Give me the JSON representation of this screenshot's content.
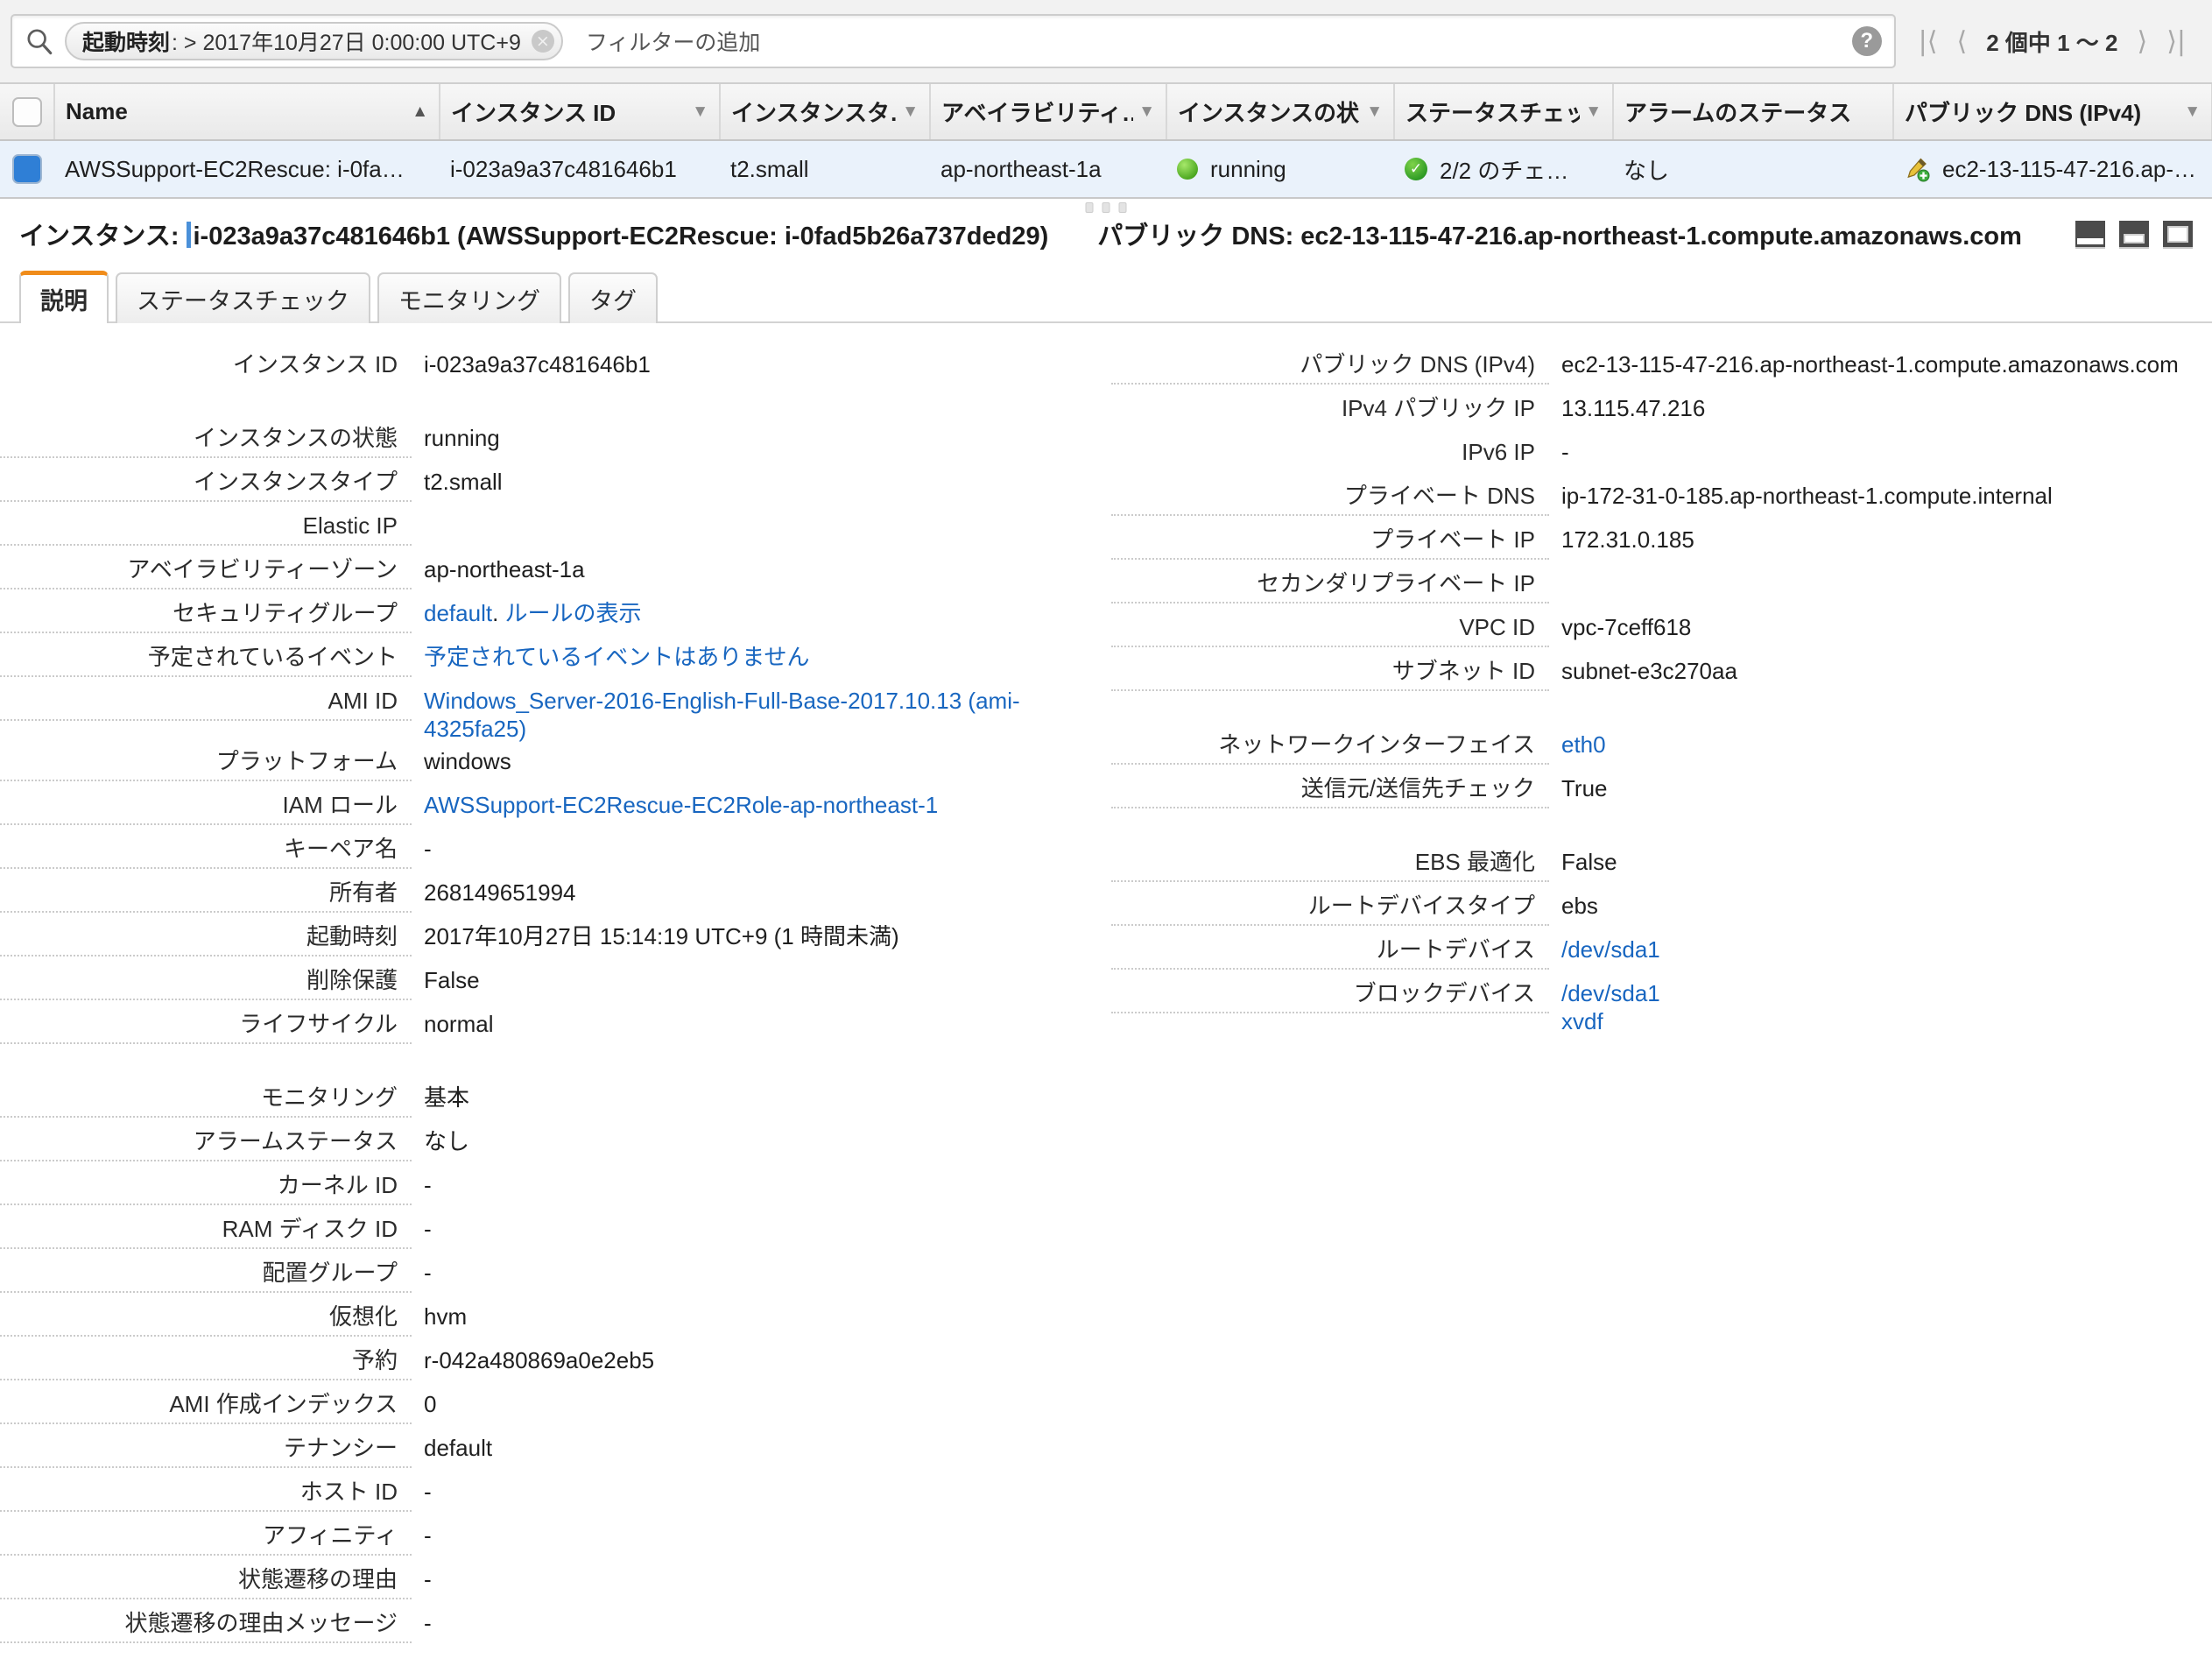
{
  "search": {
    "icon": "search-icon",
    "filter_token": {
      "key": "起動時刻",
      "operator_value": " : > 2017年10月27日 0:00:00 UTC+9",
      "remove_icon": "×"
    },
    "placeholder_text": "フィルターの追加",
    "help_icon": "?"
  },
  "pager": {
    "first": "|⟨",
    "prev": "⟨",
    "count_label": "2 個中 1 〜 2",
    "next": "⟩",
    "last": "⟩|"
  },
  "table": {
    "columns": [
      {
        "label": "Name",
        "sort": "▲",
        "sort_state": "asc"
      },
      {
        "label": "インスタンス ID",
        "sort": "▼",
        "sort_state": "none"
      },
      {
        "label": "インスタンスタ…",
        "sort": "▼",
        "sort_state": "none"
      },
      {
        "label": "アベイラビリティ…",
        "sort": "▼",
        "sort_state": "none"
      },
      {
        "label": "インスタンスの状",
        "sort": "▼",
        "sort_state": "none"
      },
      {
        "label": "ステータスチェッ",
        "sort": "▼",
        "sort_state": "none"
      },
      {
        "label": "アラームのステータス",
        "sort": "",
        "sort_state": "none"
      },
      {
        "label": "パブリック DNS (IPv4)",
        "sort": "▼",
        "sort_state": "none"
      }
    ],
    "rows": [
      {
        "selected": true,
        "name": "AWSSupport-EC2Rescue: i-0fa…",
        "instance_id": "i-023a9a37c481646b1",
        "instance_type": "t2.small",
        "availability_zone": "ap-northeast-1a",
        "state": "running",
        "status_check": "2/2 のチェ…",
        "alarm_status": "なし",
        "public_dns": "ec2-13-115-47-216.ap-…"
      }
    ]
  },
  "detail_header": {
    "prefix": "インスタンス:",
    "instance_title": "i-023a9a37c481646b1 (AWSSupport-EC2Rescue: i-0fad5b26a737ded29)",
    "dns_label": "パブリック DNS: ec2-13-115-47-216.ap-northeast-1.compute.amazonaws.com",
    "window_buttons": [
      "minimize-panel",
      "half-panel",
      "maximize-panel"
    ]
  },
  "tabs": [
    {
      "label": "説明",
      "active": true
    },
    {
      "label": "ステータスチェック",
      "active": false
    },
    {
      "label": "モニタリング",
      "active": false
    },
    {
      "label": "タグ",
      "active": false
    }
  ],
  "details_left": [
    {
      "label": "インスタンス ID",
      "value": "i-023a9a37c481646b1",
      "dashed": false,
      "gap_after": true
    },
    {
      "label": "インスタンスの状態",
      "value": "running",
      "dashed": true
    },
    {
      "label": "インスタンスタイプ",
      "value": "t2.small",
      "dashed": true
    },
    {
      "label": "Elastic IP",
      "value": "",
      "dashed": true
    },
    {
      "label": "アベイラビリティーゾーン",
      "value": "ap-northeast-1a",
      "dashed": true
    },
    {
      "label": "セキュリティグループ",
      "value": "",
      "dashed": true,
      "links": [
        {
          "text": "default"
        },
        {
          "text": ". ",
          "plain": true
        },
        {
          "text": "ルールの表示"
        }
      ]
    },
    {
      "label": "予定されているイベント",
      "value": "",
      "dashed": true,
      "links": [
        {
          "text": "予定されているイベントはありません"
        }
      ]
    },
    {
      "label": "AMI ID",
      "value": "",
      "dashed": true,
      "links": [
        {
          "text": "Windows_Server-2016-English-Full-Base-2017.10.13 (ami-4325fa25)"
        }
      ]
    },
    {
      "label": "プラットフォーム",
      "value": "windows",
      "dashed": true
    },
    {
      "label": "IAM ロール",
      "value": "",
      "dashed": true,
      "links": [
        {
          "text": "AWSSupport-EC2Rescue-EC2Role-ap-northeast-1"
        }
      ]
    },
    {
      "label": "キーペア名",
      "value": "-",
      "dashed": true
    },
    {
      "label": "所有者",
      "value": "268149651994",
      "dashed": true
    },
    {
      "label": "起動時刻",
      "value": "2017年10月27日 15:14:19 UTC+9 (1 時間未満)",
      "dashed": true
    },
    {
      "label": "削除保護",
      "value": "False",
      "dashed": true
    },
    {
      "label": "ライフサイクル",
      "value": "normal",
      "dashed": true,
      "gap_after": true
    },
    {
      "label": "モニタリング",
      "value": "基本",
      "dashed": true
    },
    {
      "label": "アラームステータス",
      "value": "なし",
      "dashed": true
    },
    {
      "label": "カーネル ID",
      "value": "-",
      "dashed": true
    },
    {
      "label": "RAM ディスク ID",
      "value": "-",
      "dashed": true
    },
    {
      "label": "配置グループ",
      "value": "-",
      "dashed": true
    },
    {
      "label": "仮想化",
      "value": "hvm",
      "dashed": true
    },
    {
      "label": "予約",
      "value": "r-042a480869a0e2eb5",
      "dashed": true
    },
    {
      "label": "AMI 作成インデックス",
      "value": "0",
      "dashed": true
    },
    {
      "label": "テナンシー",
      "value": "default",
      "dashed": true
    },
    {
      "label": "ホスト ID",
      "value": "-",
      "dashed": true
    },
    {
      "label": "アフィニティ",
      "value": "-",
      "dashed": true
    },
    {
      "label": "状態遷移の理由",
      "value": "-",
      "dashed": true
    },
    {
      "label": "状態遷移の理由メッセージ",
      "value": "-",
      "dashed": true
    }
  ],
  "details_right": [
    {
      "label": "パブリック DNS (IPv4)",
      "value": "ec2-13-115-47-216.ap-northeast-1.compute.amazonaws.com",
      "dashed": true
    },
    {
      "label": "IPv4 パブリック IP",
      "value": "13.115.47.216",
      "dashed": false
    },
    {
      "label": "IPv6 IP",
      "value": "-",
      "dashed": false
    },
    {
      "label": "プライベート DNS",
      "value": "ip-172-31-0-185.ap-northeast-1.compute.internal",
      "dashed": true
    },
    {
      "label": "プライベート IP",
      "value": "172.31.0.185",
      "dashed": true
    },
    {
      "label": "セカンダリプライベート IP",
      "value": "",
      "dashed": true
    },
    {
      "label": "VPC ID",
      "value": "vpc-7ceff618",
      "dashed": true
    },
    {
      "label": "サブネット ID",
      "value": "subnet-e3c270aa",
      "dashed": true,
      "gap_after": true
    },
    {
      "label": "ネットワークインターフェイス",
      "value": "",
      "dashed": true,
      "links": [
        {
          "text": "eth0"
        }
      ]
    },
    {
      "label": "送信元/送信先チェック",
      "value": "True",
      "dashed": true,
      "gap_after": true
    },
    {
      "label": "EBS 最適化",
      "value": "False",
      "dashed": true
    },
    {
      "label": "ルートデバイスタイプ",
      "value": "ebs",
      "dashed": true
    },
    {
      "label": "ルートデバイス",
      "value": "",
      "dashed": true,
      "links": [
        {
          "text": "/dev/sda1"
        }
      ]
    },
    {
      "label": "ブロックデバイス",
      "value": "",
      "dashed": true,
      "links": [
        {
          "text": "/dev/sda1"
        },
        {
          "text": "xvdf",
          "newline": true
        }
      ]
    }
  ],
  "colors": {
    "accent_orange": "#f08c1a",
    "link_blue": "#1866c0",
    "selected_row": "#eaf2fb",
    "checkbox_blue": "#2f7fd6",
    "status_green": "#4faa22"
  }
}
